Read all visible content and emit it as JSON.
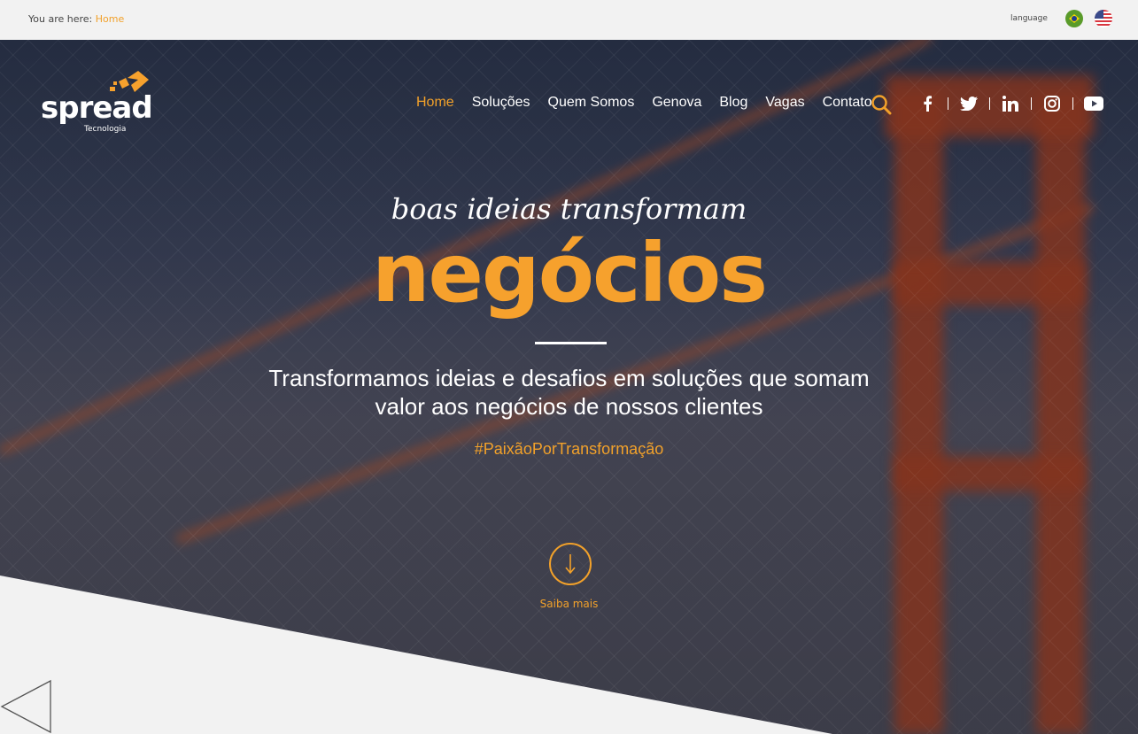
{
  "breadcrumb": {
    "prefix": "You are here:",
    "current": "Home"
  },
  "language": {
    "label": "language",
    "options": [
      "Português",
      "English"
    ]
  },
  "brand": {
    "name": "spread",
    "subtitle": "Tecnologia",
    "accent": "#f2a12a"
  },
  "nav": {
    "items": [
      "Home",
      "Soluções",
      "Quem Somos",
      "Genova",
      "Blog",
      "Vagas",
      "Contato"
    ],
    "active": "Home"
  },
  "social": [
    "facebook-icon",
    "twitter-icon",
    "linkedin-icon",
    "instagram-icon",
    "youtube-icon"
  ],
  "hero": {
    "tagline": "boas ideias transformam",
    "headline": "negócios",
    "description_line1": "Transformamos ideias e desafios em soluções que somam",
    "description_line2": "valor aos negócios de nossos clientes",
    "hashtag": "#PaixãoPorTransformação",
    "cta": "Saiba mais"
  }
}
